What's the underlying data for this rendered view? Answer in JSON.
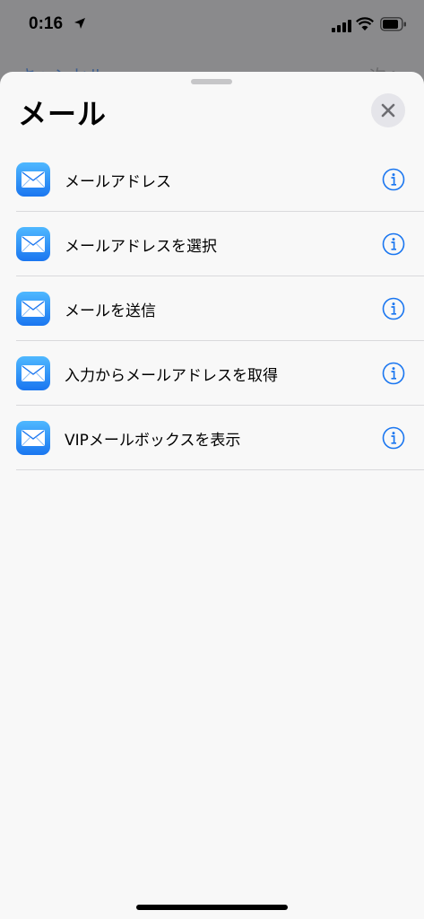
{
  "status_bar": {
    "time": "0:16"
  },
  "background_screen": {
    "cancel_label": "キャンセル",
    "next_label": "次へ"
  },
  "sheet": {
    "title": "メール"
  },
  "actions": [
    {
      "label": "メールアドレス",
      "icon": "mail-app-icon"
    },
    {
      "label": "メールアドレスを選択",
      "icon": "mail-app-icon"
    },
    {
      "label": "メールを送信",
      "icon": "mail-app-icon"
    },
    {
      "label": "入力からメールアドレスを取得",
      "icon": "mail-app-icon"
    },
    {
      "label": "VIPメールボックスを表示",
      "icon": "mail-app-icon"
    }
  ],
  "colors": {
    "accent": "#1a76f0",
    "sheet_background": "#f8f8f8"
  }
}
